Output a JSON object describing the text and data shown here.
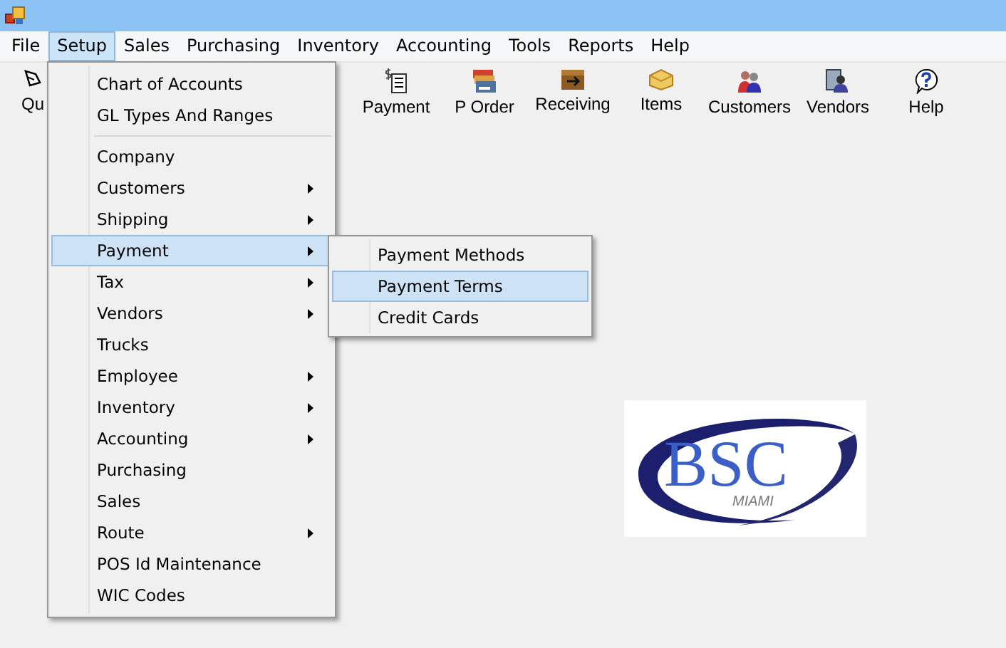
{
  "menubar": [
    {
      "label": "File",
      "selected": false
    },
    {
      "label": "Setup",
      "selected": true
    },
    {
      "label": "Sales",
      "selected": false
    },
    {
      "label": "Purchasing",
      "selected": false
    },
    {
      "label": "Inventory",
      "selected": false
    },
    {
      "label": "Accounting",
      "selected": false
    },
    {
      "label": "Tools",
      "selected": false
    },
    {
      "label": "Reports",
      "selected": false
    },
    {
      "label": "Help",
      "selected": false
    }
  ],
  "toolbar_partial": {
    "label": "Qu"
  },
  "toolbar": [
    {
      "label": "Payment",
      "kind": "payment"
    },
    {
      "label": "P Order",
      "kind": "order"
    },
    {
      "label": "Receiving",
      "kind": "receiving"
    },
    {
      "label": "Items",
      "kind": "items"
    },
    {
      "label": "Customers",
      "kind": "customers"
    },
    {
      "label": "Vendors",
      "kind": "vendors"
    },
    {
      "label": "Help",
      "kind": "help"
    }
  ],
  "setup_menu": {
    "sections": [
      [
        {
          "label": "Chart of Accounts",
          "has_submenu": false,
          "selected": false
        },
        {
          "label": "GL Types And Ranges",
          "has_submenu": false,
          "selected": false
        }
      ],
      [
        {
          "label": "Company",
          "has_submenu": false,
          "selected": false
        },
        {
          "label": "Customers",
          "has_submenu": true,
          "selected": false
        },
        {
          "label": "Shipping",
          "has_submenu": true,
          "selected": false
        },
        {
          "label": "Payment",
          "has_submenu": true,
          "selected": true
        },
        {
          "label": "Tax",
          "has_submenu": true,
          "selected": false
        },
        {
          "label": "Vendors",
          "has_submenu": true,
          "selected": false
        },
        {
          "label": "Trucks",
          "has_submenu": false,
          "selected": false
        },
        {
          "label": "Employee",
          "has_submenu": true,
          "selected": false
        },
        {
          "label": "Inventory",
          "has_submenu": true,
          "selected": false
        },
        {
          "label": "Accounting",
          "has_submenu": true,
          "selected": false
        },
        {
          "label": "Purchasing",
          "has_submenu": false,
          "selected": false
        },
        {
          "label": "Sales",
          "has_submenu": false,
          "selected": false
        },
        {
          "label": "Route",
          "has_submenu": true,
          "selected": false
        },
        {
          "label": "POS Id Maintenance",
          "has_submenu": false,
          "selected": false
        },
        {
          "label": "WIC Codes",
          "has_submenu": false,
          "selected": false
        }
      ]
    ]
  },
  "payment_submenu": [
    {
      "label": "Payment Methods",
      "selected": false
    },
    {
      "label": "Payment Terms",
      "selected": true
    },
    {
      "label": "Credit Cards",
      "selected": false
    }
  ],
  "logo": {
    "name": "BSC",
    "place": "MIAMI"
  }
}
